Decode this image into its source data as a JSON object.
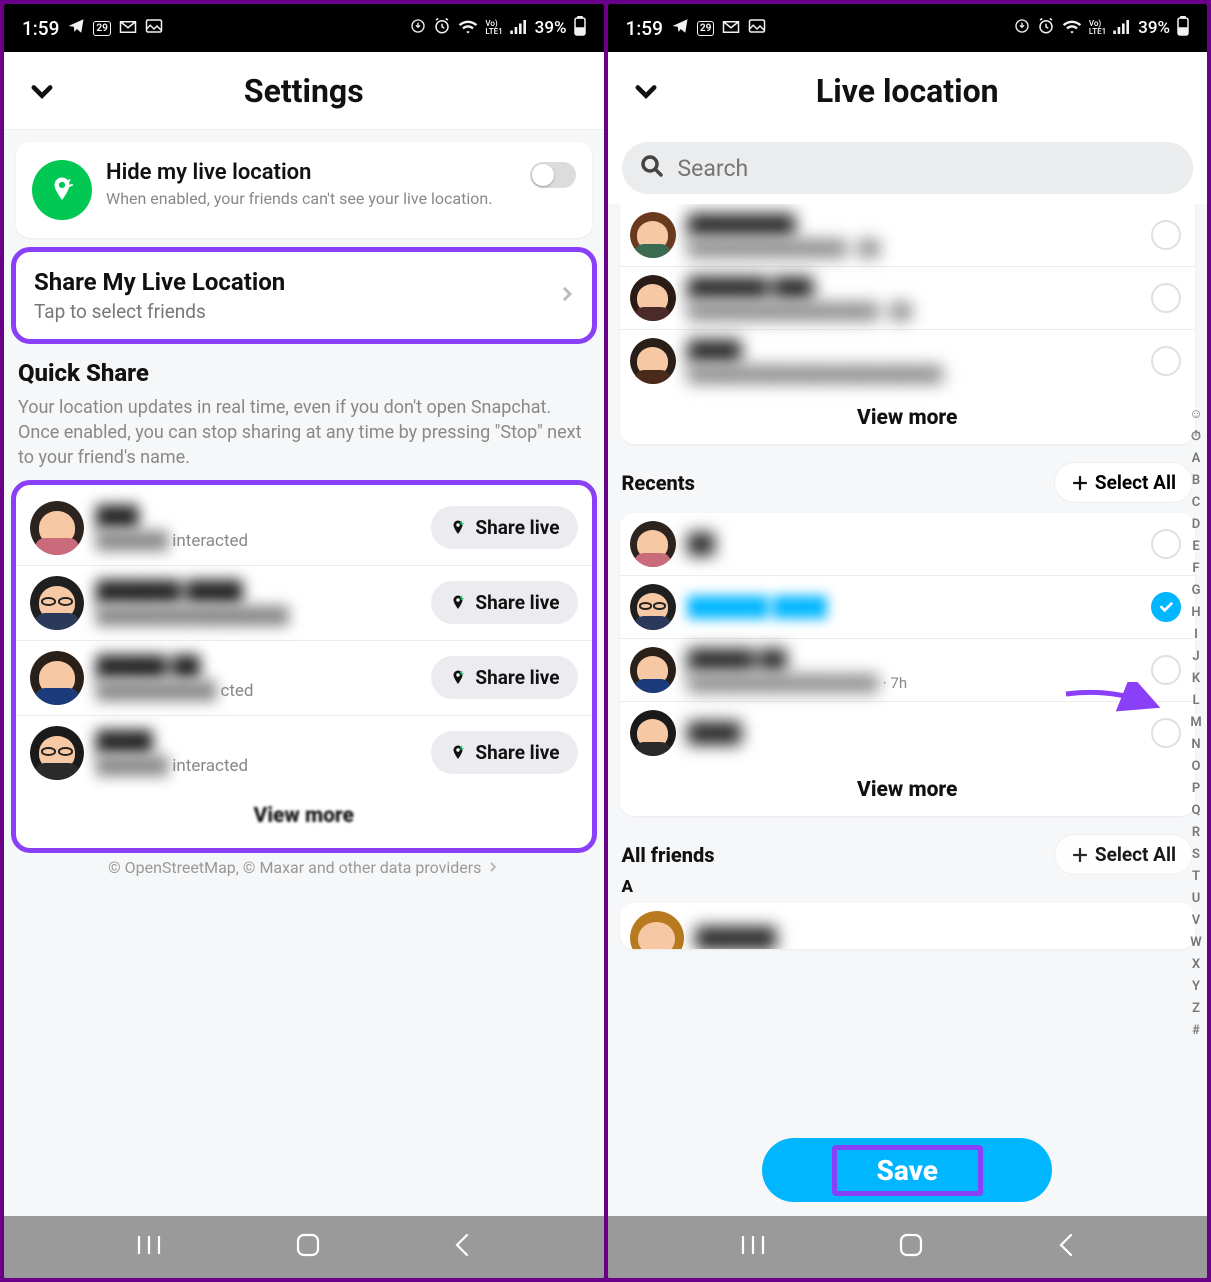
{
  "status": {
    "time": "1:59",
    "battery_pct": "39%",
    "net_label": "LTE1",
    "volte": "Vo)"
  },
  "left": {
    "title": "Settings",
    "hide": {
      "title": "Hide my live location",
      "subtitle": "When enabled, your friends can't see your live location.",
      "toggle_on": false
    },
    "share": {
      "title": "Share My Live Location",
      "subtitle": "Tap to select friends"
    },
    "quick": {
      "title": "Quick Share",
      "subtitle": "Your location updates in real time, even if you don't open Snapchat. Once enabled, you can stop sharing at any time by pressing \"Stop\" next to your friend's name."
    },
    "share_live_label": "Share live",
    "friends": [
      {
        "name": "███",
        "sub_blur": "██████",
        "sub_tail": "interacted",
        "hair": "#2d241f",
        "body": "#c96b7a"
      },
      {
        "name": "██████ ████",
        "sub_blur": "████████████████",
        "sub_tail": "",
        "hair": "#1f1f1f",
        "body": "#2b3a5a",
        "glasses": true
      },
      {
        "name": "█████ ██",
        "sub_blur": "██████████",
        "sub_tail": "cted",
        "hair": "#2a201a",
        "body": "#1c3b7a"
      },
      {
        "name": "████",
        "sub_blur": "██████",
        "sub_tail": "interacted",
        "hair": "#1a1a1a",
        "body": "#2a2a2a",
        "glasses": true
      }
    ],
    "view_more": "View more",
    "credit": "© OpenStreetMap, © Maxar and other data providers"
  },
  "right": {
    "title": "Live location",
    "search_placeholder": "Search",
    "top_friends": [
      {
        "name": "████████",
        "sub": "███████████████ · ██",
        "hair": "#6a3a1f",
        "body": "#3a6a4f"
      },
      {
        "name": "██████ ███",
        "sub": "██████████████████ · ██",
        "hair": "#2b1b16",
        "body": "#4a2a2a"
      },
      {
        "name": "████",
        "sub": "████████████████████████ ..",
        "hair": "#2a1f18",
        "body": "#4a2a1a"
      }
    ],
    "view_more": "View more",
    "recents_label": "Recents",
    "select_all_label": "Select All",
    "recents": [
      {
        "name": "██",
        "sub": "",
        "selected": false,
        "hair": "#2d241f",
        "body": "#c96b7a"
      },
      {
        "name": "██████ ████",
        "sub": "",
        "selected": true,
        "hair": "#1f1f1f",
        "body": "#2b3a5a",
        "glasses": true,
        "bluename": true
      },
      {
        "name": "█████ ██",
        "sub": "██████████████████",
        "tail": " · 7h",
        "selected": false,
        "hair": "#2a201a",
        "body": "#1c3b7a"
      },
      {
        "name": "████",
        "sub": "",
        "selected": false,
        "hair": "#1a1a1a",
        "body": "#2a2a2a"
      }
    ],
    "all_friends_label": "All friends",
    "alpha_letter": "A",
    "alpha_index": [
      "☺",
      "⏱",
      "A",
      "B",
      "C",
      "D",
      "E",
      "F",
      "G",
      "H",
      "I",
      "J",
      "K",
      "L",
      "M",
      "N",
      "O",
      "P",
      "Q",
      "R",
      "S",
      "T",
      "U",
      "V",
      "W",
      "X",
      "Y",
      "Z",
      "#"
    ],
    "save_label": "Save"
  }
}
